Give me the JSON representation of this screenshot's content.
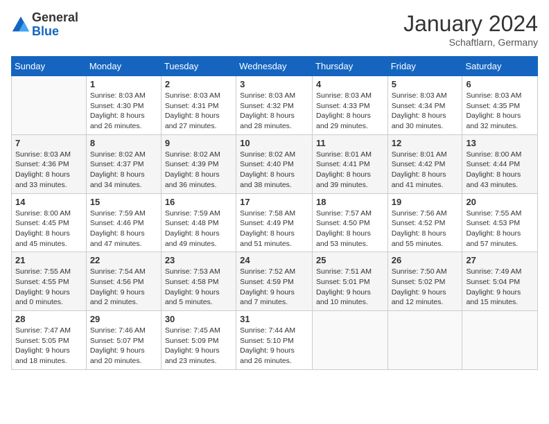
{
  "logo": {
    "general": "General",
    "blue": "Blue"
  },
  "header": {
    "month": "January 2024",
    "location": "Schaftlarn, Germany"
  },
  "weekdays": [
    "Sunday",
    "Monday",
    "Tuesday",
    "Wednesday",
    "Thursday",
    "Friday",
    "Saturday"
  ],
  "weeks": [
    [
      {
        "day": "",
        "empty": true
      },
      {
        "day": "1",
        "sunrise": "Sunrise: 8:03 AM",
        "sunset": "Sunset: 4:30 PM",
        "daylight": "Daylight: 8 hours and 26 minutes."
      },
      {
        "day": "2",
        "sunrise": "Sunrise: 8:03 AM",
        "sunset": "Sunset: 4:31 PM",
        "daylight": "Daylight: 8 hours and 27 minutes."
      },
      {
        "day": "3",
        "sunrise": "Sunrise: 8:03 AM",
        "sunset": "Sunset: 4:32 PM",
        "daylight": "Daylight: 8 hours and 28 minutes."
      },
      {
        "day": "4",
        "sunrise": "Sunrise: 8:03 AM",
        "sunset": "Sunset: 4:33 PM",
        "daylight": "Daylight: 8 hours and 29 minutes."
      },
      {
        "day": "5",
        "sunrise": "Sunrise: 8:03 AM",
        "sunset": "Sunset: 4:34 PM",
        "daylight": "Daylight: 8 hours and 30 minutes."
      },
      {
        "day": "6",
        "sunrise": "Sunrise: 8:03 AM",
        "sunset": "Sunset: 4:35 PM",
        "daylight": "Daylight: 8 hours and 32 minutes."
      }
    ],
    [
      {
        "day": "7",
        "sunrise": "Sunrise: 8:03 AM",
        "sunset": "Sunset: 4:36 PM",
        "daylight": "Daylight: 8 hours and 33 minutes."
      },
      {
        "day": "8",
        "sunrise": "Sunrise: 8:02 AM",
        "sunset": "Sunset: 4:37 PM",
        "daylight": "Daylight: 8 hours and 34 minutes."
      },
      {
        "day": "9",
        "sunrise": "Sunrise: 8:02 AM",
        "sunset": "Sunset: 4:39 PM",
        "daylight": "Daylight: 8 hours and 36 minutes."
      },
      {
        "day": "10",
        "sunrise": "Sunrise: 8:02 AM",
        "sunset": "Sunset: 4:40 PM",
        "daylight": "Daylight: 8 hours and 38 minutes."
      },
      {
        "day": "11",
        "sunrise": "Sunrise: 8:01 AM",
        "sunset": "Sunset: 4:41 PM",
        "daylight": "Daylight: 8 hours and 39 minutes."
      },
      {
        "day": "12",
        "sunrise": "Sunrise: 8:01 AM",
        "sunset": "Sunset: 4:42 PM",
        "daylight": "Daylight: 8 hours and 41 minutes."
      },
      {
        "day": "13",
        "sunrise": "Sunrise: 8:00 AM",
        "sunset": "Sunset: 4:44 PM",
        "daylight": "Daylight: 8 hours and 43 minutes."
      }
    ],
    [
      {
        "day": "14",
        "sunrise": "Sunrise: 8:00 AM",
        "sunset": "Sunset: 4:45 PM",
        "daylight": "Daylight: 8 hours and 45 minutes."
      },
      {
        "day": "15",
        "sunrise": "Sunrise: 7:59 AM",
        "sunset": "Sunset: 4:46 PM",
        "daylight": "Daylight: 8 hours and 47 minutes."
      },
      {
        "day": "16",
        "sunrise": "Sunrise: 7:59 AM",
        "sunset": "Sunset: 4:48 PM",
        "daylight": "Daylight: 8 hours and 49 minutes."
      },
      {
        "day": "17",
        "sunrise": "Sunrise: 7:58 AM",
        "sunset": "Sunset: 4:49 PM",
        "daylight": "Daylight: 8 hours and 51 minutes."
      },
      {
        "day": "18",
        "sunrise": "Sunrise: 7:57 AM",
        "sunset": "Sunset: 4:50 PM",
        "daylight": "Daylight: 8 hours and 53 minutes."
      },
      {
        "day": "19",
        "sunrise": "Sunrise: 7:56 AM",
        "sunset": "Sunset: 4:52 PM",
        "daylight": "Daylight: 8 hours and 55 minutes."
      },
      {
        "day": "20",
        "sunrise": "Sunrise: 7:55 AM",
        "sunset": "Sunset: 4:53 PM",
        "daylight": "Daylight: 8 hours and 57 minutes."
      }
    ],
    [
      {
        "day": "21",
        "sunrise": "Sunrise: 7:55 AM",
        "sunset": "Sunset: 4:55 PM",
        "daylight": "Daylight: 9 hours and 0 minutes."
      },
      {
        "day": "22",
        "sunrise": "Sunrise: 7:54 AM",
        "sunset": "Sunset: 4:56 PM",
        "daylight": "Daylight: 9 hours and 2 minutes."
      },
      {
        "day": "23",
        "sunrise": "Sunrise: 7:53 AM",
        "sunset": "Sunset: 4:58 PM",
        "daylight": "Daylight: 9 hours and 5 minutes."
      },
      {
        "day": "24",
        "sunrise": "Sunrise: 7:52 AM",
        "sunset": "Sunset: 4:59 PM",
        "daylight": "Daylight: 9 hours and 7 minutes."
      },
      {
        "day": "25",
        "sunrise": "Sunrise: 7:51 AM",
        "sunset": "Sunset: 5:01 PM",
        "daylight": "Daylight: 9 hours and 10 minutes."
      },
      {
        "day": "26",
        "sunrise": "Sunrise: 7:50 AM",
        "sunset": "Sunset: 5:02 PM",
        "daylight": "Daylight: 9 hours and 12 minutes."
      },
      {
        "day": "27",
        "sunrise": "Sunrise: 7:49 AM",
        "sunset": "Sunset: 5:04 PM",
        "daylight": "Daylight: 9 hours and 15 minutes."
      }
    ],
    [
      {
        "day": "28",
        "sunrise": "Sunrise: 7:47 AM",
        "sunset": "Sunset: 5:05 PM",
        "daylight": "Daylight: 9 hours and 18 minutes."
      },
      {
        "day": "29",
        "sunrise": "Sunrise: 7:46 AM",
        "sunset": "Sunset: 5:07 PM",
        "daylight": "Daylight: 9 hours and 20 minutes."
      },
      {
        "day": "30",
        "sunrise": "Sunrise: 7:45 AM",
        "sunset": "Sunset: 5:09 PM",
        "daylight": "Daylight: 9 hours and 23 minutes."
      },
      {
        "day": "31",
        "sunrise": "Sunrise: 7:44 AM",
        "sunset": "Sunset: 5:10 PM",
        "daylight": "Daylight: 9 hours and 26 minutes."
      },
      {
        "day": "",
        "empty": true
      },
      {
        "day": "",
        "empty": true
      },
      {
        "day": "",
        "empty": true
      }
    ]
  ]
}
